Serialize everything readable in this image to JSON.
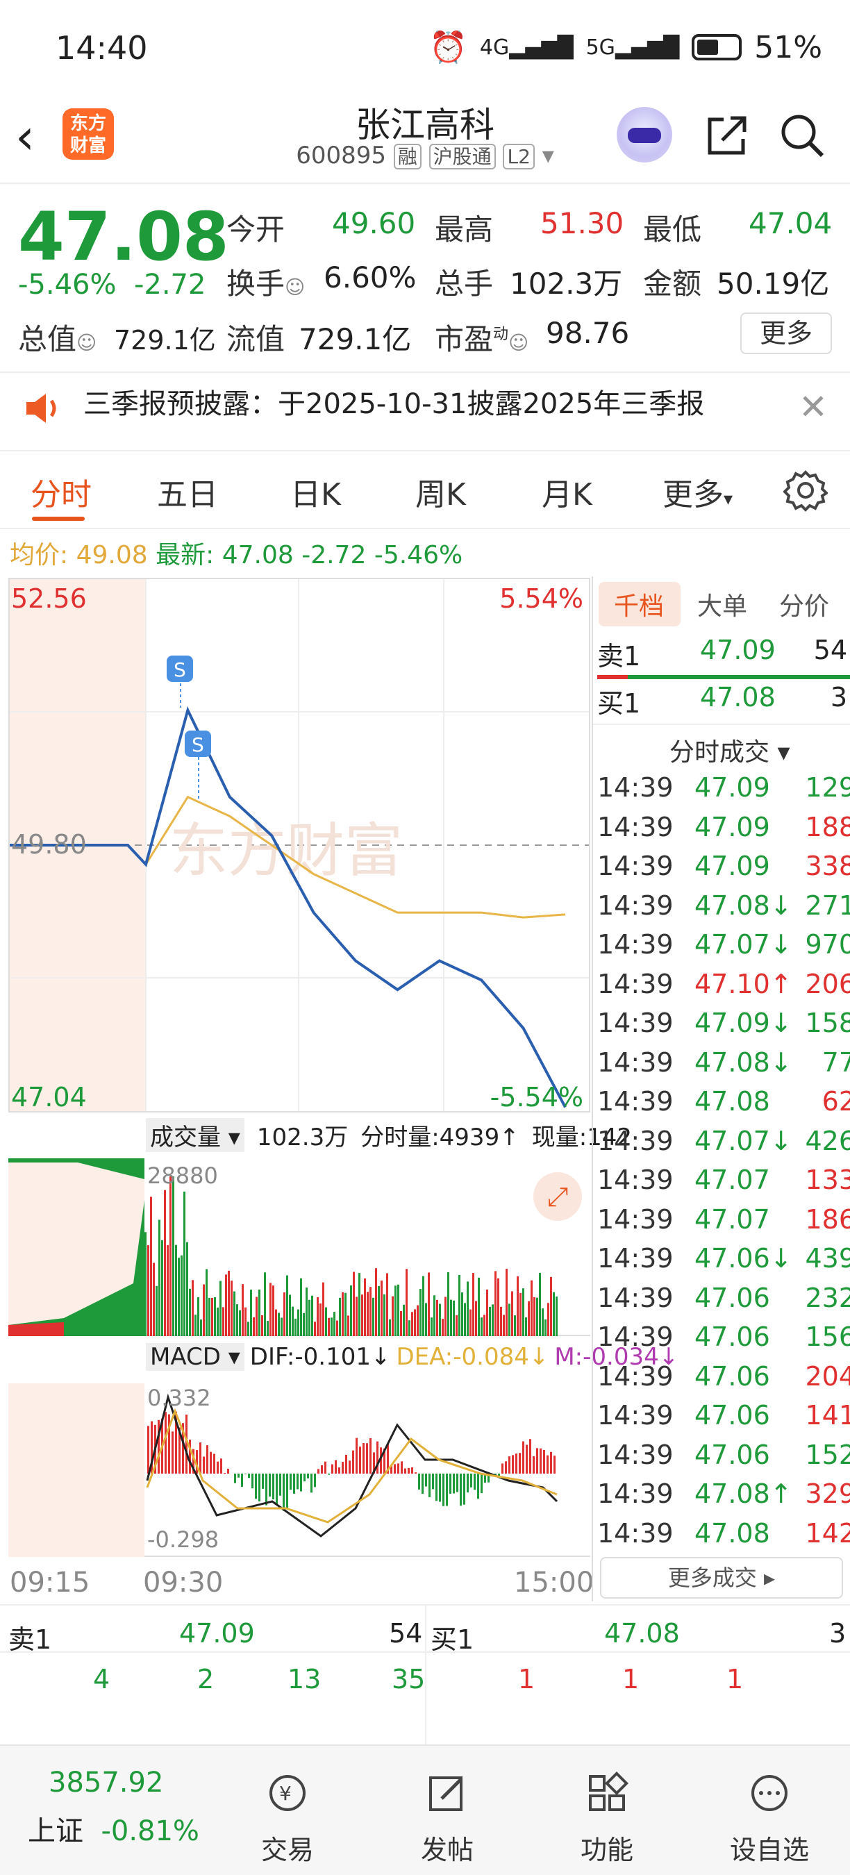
{
  "status": {
    "time": "14:40",
    "net1": "4G",
    "net2": "5G",
    "battery": "51%"
  },
  "header": {
    "name": "张江高科",
    "code": "600895",
    "tag1": "融",
    "tag2": "沪股通",
    "tag3": "L2",
    "logo_line1": "东方",
    "logo_line2": "财富"
  },
  "quote": {
    "price": "47.08",
    "chg_pct": "-5.46%",
    "chg": "-2.72",
    "open_label": "今开",
    "open": "49.60",
    "high_label": "最高",
    "high": "51.30",
    "low_label": "最低",
    "low": "47.04",
    "turnover_label": "换手",
    "turnover": "6.60%",
    "volume_label": "总手",
    "volume": "102.3万",
    "amount_label": "金额",
    "amount": "50.19亿",
    "mktcap_label": "总值",
    "mktcap": "729.1亿",
    "float_label": "流值",
    "float": "729.1亿",
    "pe_label": "市盈",
    "pe_sup": "动",
    "pe": "98.76",
    "more": "更多"
  },
  "notice": {
    "text": "三季报预披露：于2025-10-31披露2025年三季报"
  },
  "tabs": [
    "分时",
    "五日",
    "日K",
    "周K",
    "月K",
    "更多"
  ],
  "avg": {
    "label_avg": "均价:",
    "avg": "49.08",
    "label_last": "最新:",
    "last": "47.08",
    "chg": "-2.72",
    "pct": "-5.46%"
  },
  "chart": {
    "ymax": "52.56",
    "ymin": "47.04",
    "pct_max": "5.54%",
    "pct_min": "-5.54%",
    "mid": "49.80",
    "watermark": "东方财富",
    "signal": "S",
    "vol_label": "成交量",
    "vol_total": "102.3万",
    "vol_min": "分时量:4939↑",
    "vol_now": "现量:142",
    "vol_max": "28880",
    "macd_label": "MACD",
    "dif": "DIF:-0.101↓",
    "dea": "DEA:-0.084↓",
    "m": "M:-0.034↓",
    "macd_max": "0.332",
    "macd_min": "-0.298",
    "t_start": "09:15",
    "t_open": "09:30",
    "t_end": "15:00"
  },
  "chart_data": {
    "type": "line",
    "x": [
      "09:30",
      "09:45",
      "10:00",
      "10:15",
      "10:30",
      "11:00",
      "11:30/13:00",
      "13:30",
      "14:00",
      "14:30",
      "14:39"
    ],
    "series": [
      {
        "values": [
          49.6,
          51.2,
          50.3,
          49.9,
          49.1,
          48.6,
          48.3,
          48.6,
          48.4,
          47.9,
          47.08
        ]
      },
      {
        "values": [
          49.6,
          50.3,
          50.1,
          49.8,
          49.5,
          49.3,
          49.1,
          49.1,
          49.1,
          49.05,
          49.08
        ]
      }
    ],
    "ylim": [
      47.04,
      52.56
    ]
  },
  "right": {
    "tabs": [
      "千档",
      "大单",
      "分价"
    ],
    "ask_label": "卖1",
    "ask_price": "47.09",
    "ask_vol": "54",
    "bid_label": "买1",
    "bid_price": "47.08",
    "bid_vol": "3",
    "ticks_title": "分时成交 ▾",
    "ticks": [
      {
        "t": "14:39",
        "p": "47.09",
        "v": "129",
        "c": "green",
        "vc": "green"
      },
      {
        "t": "14:39",
        "p": "47.09",
        "v": "188",
        "c": "green",
        "vc": "red"
      },
      {
        "t": "14:39",
        "p": "47.09",
        "v": "338",
        "c": "green",
        "vc": "red"
      },
      {
        "t": "14:39",
        "p": "47.08↓",
        "v": "271",
        "c": "green",
        "vc": "green"
      },
      {
        "t": "14:39",
        "p": "47.07↓",
        "v": "970",
        "c": "green",
        "vc": "green"
      },
      {
        "t": "14:39",
        "p": "47.10↑",
        "v": "206",
        "c": "red",
        "vc": "red"
      },
      {
        "t": "14:39",
        "p": "47.09↓",
        "v": "158",
        "c": "green",
        "vc": "green"
      },
      {
        "t": "14:39",
        "p": "47.08↓",
        "v": "77",
        "c": "green",
        "vc": "green"
      },
      {
        "t": "14:39",
        "p": "47.08",
        "v": "62",
        "c": "green",
        "vc": "red"
      },
      {
        "t": "14:39",
        "p": "47.07↓",
        "v": "426",
        "c": "green",
        "vc": "green"
      },
      {
        "t": "14:39",
        "p": "47.07",
        "v": "133",
        "c": "green",
        "vc": "red"
      },
      {
        "t": "14:39",
        "p": "47.07",
        "v": "186",
        "c": "green",
        "vc": "red"
      },
      {
        "t": "14:39",
        "p": "47.06↓",
        "v": "439",
        "c": "green",
        "vc": "green"
      },
      {
        "t": "14:39",
        "p": "47.06",
        "v": "232",
        "c": "green",
        "vc": "green"
      },
      {
        "t": "14:39",
        "p": "47.06",
        "v": "156",
        "c": "green",
        "vc": "green"
      },
      {
        "t": "14:39",
        "p": "47.06",
        "v": "204",
        "c": "green",
        "vc": "red"
      },
      {
        "t": "14:39",
        "p": "47.06",
        "v": "141",
        "c": "green",
        "vc": "red"
      },
      {
        "t": "14:39",
        "p": "47.06",
        "v": "152",
        "c": "green",
        "vc": "green"
      },
      {
        "t": "14:39",
        "p": "47.08↑",
        "v": "329",
        "c": "green",
        "vc": "red"
      },
      {
        "t": "14:39",
        "p": "47.08",
        "v": "142",
        "c": "green",
        "vc": "red"
      }
    ],
    "more_trades": "更多成交 ▸"
  },
  "book": {
    "ask_label": "卖1",
    "ask_price": "47.09",
    "ask_vol": "54",
    "bid_label": "买1",
    "bid_price": "47.08",
    "bid_vol": "3",
    "ask_queue": [
      "4",
      "2",
      "13",
      "35"
    ],
    "bid_queue": [
      "1",
      "1",
      "1"
    ]
  },
  "index": {
    "value": "3857.92",
    "name": "上证",
    "pct": "-0.81%"
  },
  "nav": [
    "交易",
    "发帖",
    "功能",
    "设自选"
  ]
}
